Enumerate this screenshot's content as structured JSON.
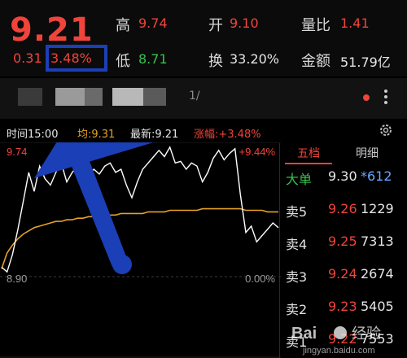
{
  "quote": {
    "price": "9.21",
    "change": "0.31",
    "change_pct": "3.48%",
    "high_label": "高",
    "high": "9.74",
    "open_label": "开",
    "open": "9.10",
    "vol_ratio_label": "量比",
    "vol_ratio": "1.41",
    "low_label": "低",
    "low": "8.71",
    "turnover_label": "换",
    "turnover": "33.20%",
    "amount_label": "金额",
    "amount": "51.79亿"
  },
  "thumbs": {
    "partial_text": "1/"
  },
  "info": {
    "time": "时间15:00",
    "avg": "均:9.31",
    "latest": "最新:9.21",
    "rise": "涨幅:+3.48%"
  },
  "chart_data": {
    "type": "line",
    "y_top_label": "9.74",
    "y_bottom_label": "8.90",
    "pct_top_label": "+9.44%",
    "pct_bottom_label": "0.00%",
    "ylim": [
      8.9,
      9.74
    ],
    "series": [
      {
        "name": "price",
        "color": "#ffffff",
        "values": [
          8.96,
          8.93,
          9.04,
          9.2,
          9.38,
          9.56,
          9.44,
          9.6,
          9.52,
          9.48,
          9.56,
          9.62,
          9.5,
          9.56,
          9.6,
          9.53,
          9.54,
          9.58,
          9.55,
          9.6,
          9.62,
          9.56,
          9.58,
          9.48,
          9.4,
          9.5,
          9.58,
          9.62,
          9.66,
          9.7,
          9.66,
          9.72,
          9.62,
          9.63,
          9.58,
          9.62,
          9.6,
          9.5,
          9.56,
          9.65,
          9.7,
          9.64,
          9.68,
          9.71,
          9.42,
          9.18,
          9.22,
          9.12,
          9.16,
          9.2,
          9.24,
          9.21
        ]
      },
      {
        "name": "average",
        "color": "#e5a126",
        "values": [
          8.95,
          9.05,
          9.1,
          9.14,
          9.17,
          9.19,
          9.21,
          9.22,
          9.23,
          9.24,
          9.25,
          9.25,
          9.26,
          9.26,
          9.27,
          9.27,
          9.28,
          9.28,
          9.28,
          9.29,
          9.29,
          9.29,
          9.3,
          9.3,
          9.3,
          9.3,
          9.3,
          9.31,
          9.31,
          9.31,
          9.31,
          9.32,
          9.32,
          9.32,
          9.32,
          9.32,
          9.32,
          9.33,
          9.33,
          9.33,
          9.33,
          9.33,
          9.33,
          9.33,
          9.33,
          9.32,
          9.32,
          9.32,
          9.32,
          9.31,
          9.31,
          9.31
        ]
      }
    ]
  },
  "panel": {
    "tab1": "五档",
    "tab2": "明细",
    "rows": [
      {
        "name": "大单",
        "price": "9.30",
        "vol": "*612"
      },
      {
        "name": "卖5",
        "price": "9.26",
        "vol": "1229"
      },
      {
        "name": "卖4",
        "price": "9.25",
        "vol": "7313"
      },
      {
        "name": "卖3",
        "price": "9.24",
        "vol": "2674"
      },
      {
        "name": "卖2",
        "price": "9.23",
        "vol": "5405"
      },
      {
        "name": "卖1",
        "price": "9.22",
        "vol": "7553"
      }
    ]
  },
  "colors": {
    "red": "#f0443a",
    "green": "#35c24a",
    "blue_marker": "#1b3fb6",
    "avg_line": "#e5a126"
  }
}
